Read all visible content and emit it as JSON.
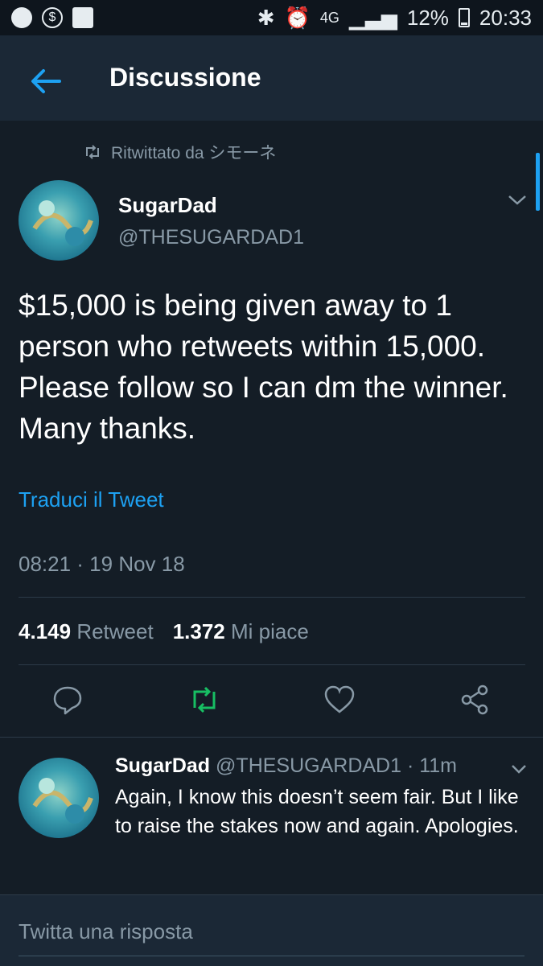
{
  "status_bar": {
    "left_icons": [
      "spotify-icon",
      "dollar-icon",
      "image-icon"
    ],
    "network": "4G",
    "battery": "12%",
    "time": "20:33"
  },
  "header": {
    "title": "Discussione"
  },
  "retweet": {
    "label": "Ritwittato da シモーネ"
  },
  "tweet": {
    "name": "SugarDad",
    "handle": "@THESUGARDAD1",
    "text": "$15,000 is being given away to 1 person who retweets within 15,000. Please follow so I can dm the winner. Many thanks.",
    "translate": "Traduci il Tweet",
    "timestamp": "08:21 · 19 Nov 18",
    "retweets_count": "4.149",
    "retweets_label": "Retweet",
    "likes_count": "1.372",
    "likes_label": "Mi piace"
  },
  "reply": {
    "name": "SugarDad",
    "meta": "@THESUGARDAD1 · 11m",
    "text": "Again, I know this doesn’t seem fair. But I like to raise the stakes now and again. Apologies."
  },
  "composer": {
    "placeholder": "Twitta una risposta"
  },
  "colors": {
    "accent": "#1da1f2",
    "retweet": "#17bf63",
    "background": "#141d26",
    "bar": "#1b2836"
  }
}
